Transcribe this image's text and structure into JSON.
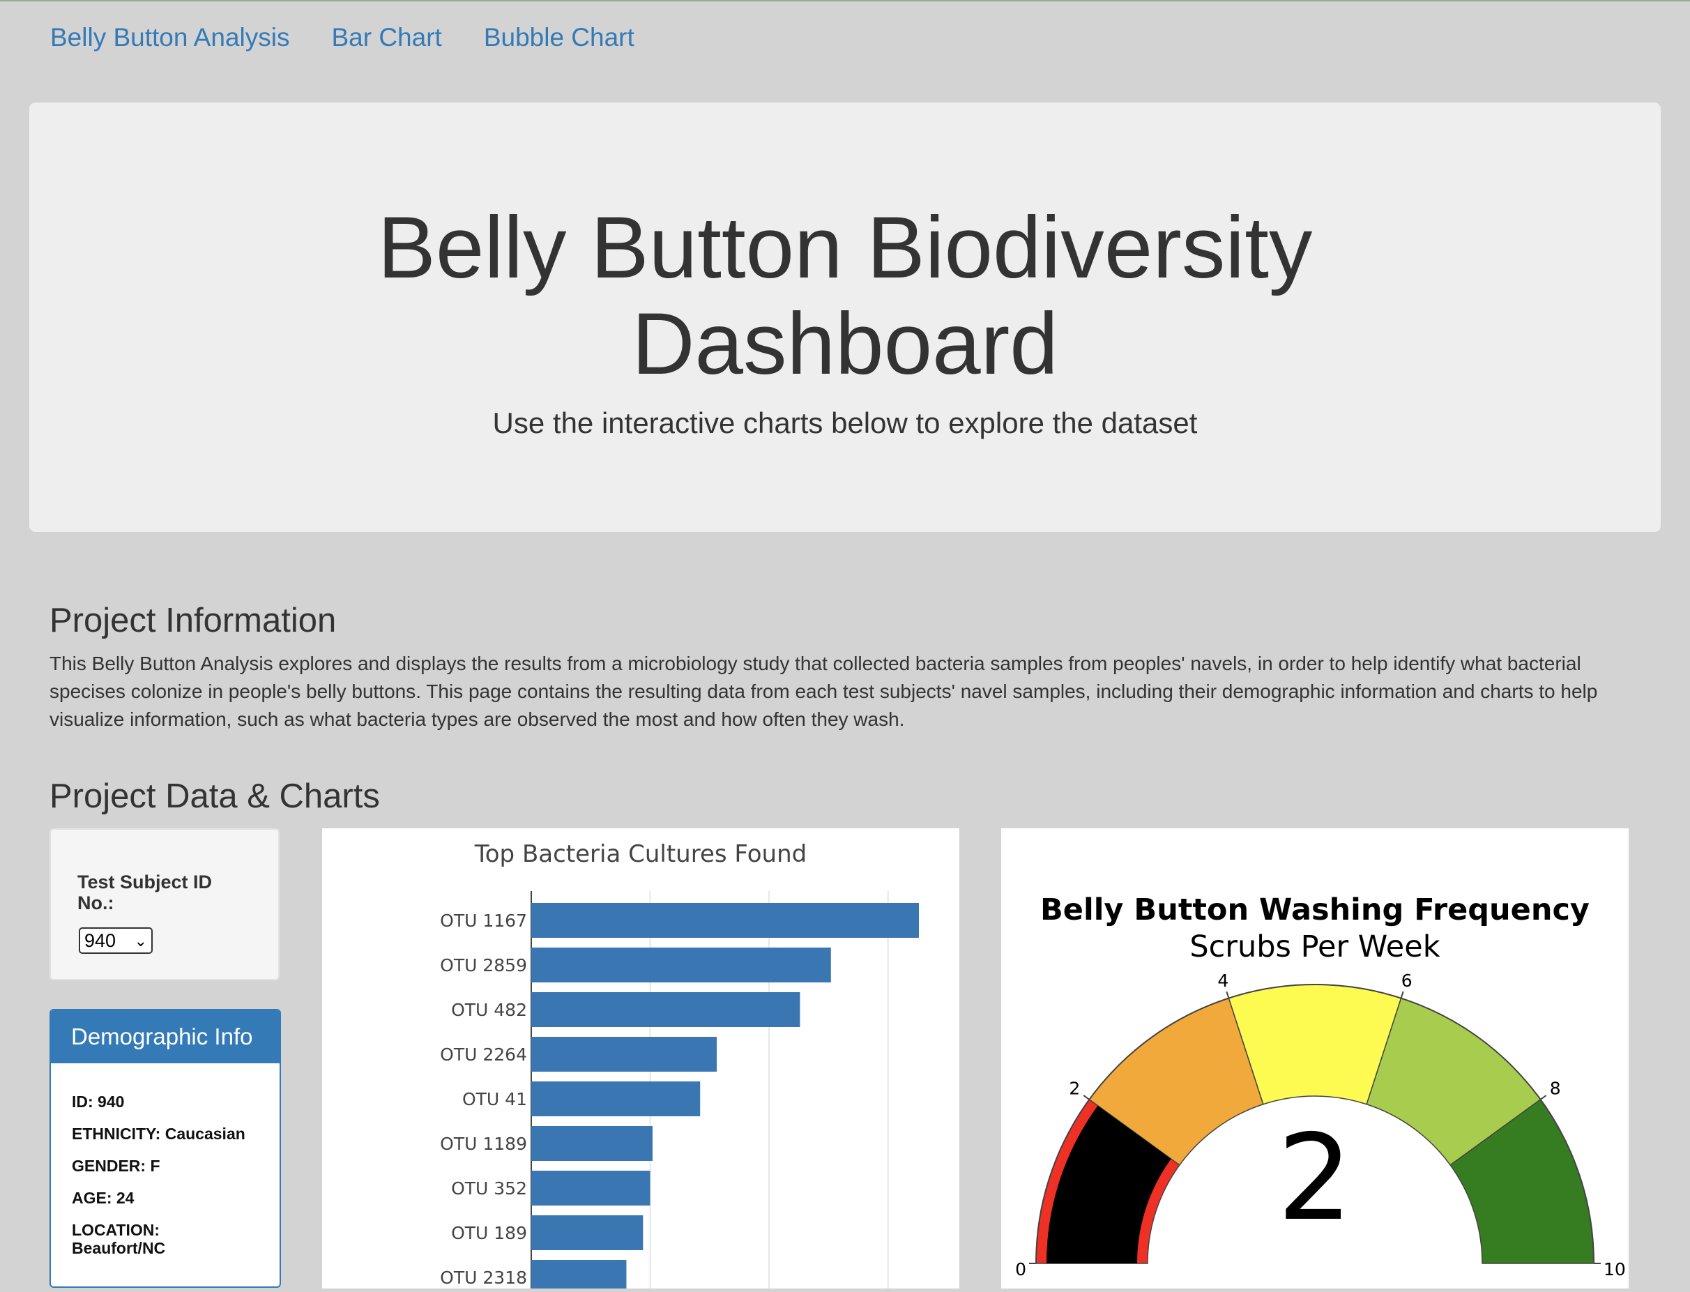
{
  "nav": {
    "items": [
      "Belly Button Analysis",
      "Bar Chart",
      "Bubble Chart"
    ]
  },
  "jumbotron": {
    "title_line1": "Belly Button Biodiversity",
    "title_line2": "Dashboard",
    "subtitle": "Use the interactive charts below to explore the dataset"
  },
  "project_info": {
    "heading": "Project Information",
    "text": "This Belly Button Analysis explores and displays the results from a microbiology study that collected bacteria samples from peoples' navels, in order to help identify what bacterial specises colonize in people's belly buttons. This page contains the resulting data from each test subjects' navel samples, including their demographic information and charts to help visualize information, such as what bacteria types are observed the most and how often they wash."
  },
  "project_data": {
    "heading": "Project Data & Charts"
  },
  "selector": {
    "label": "Test Subject ID No.:",
    "value": "940"
  },
  "demographic": {
    "title": "Demographic Info",
    "rows": [
      "ID: 940",
      "ETHNICITY: Caucasian",
      "GENDER: F",
      "AGE: 24",
      "LOCATION: Beaufort/NC"
    ]
  },
  "chart_data": [
    {
      "type": "bar",
      "orientation": "horizontal",
      "title": "Top Bacteria Cultures Found",
      "categories": [
        "OTU 1167",
        "OTU 2859",
        "OTU 482",
        "OTU 2264",
        "OTU 41",
        "OTU 1189",
        "OTU 352",
        "OTU 189",
        "OTU 2318"
      ],
      "values": [
        163,
        126,
        113,
        78,
        71,
        51,
        50,
        47,
        40
      ],
      "xlim": [
        0,
        180
      ],
      "grid": true,
      "bar_color": "#3a76b1"
    },
    {
      "type": "gauge",
      "title": "Belly Button Washing Frequency",
      "subtitle": "Scrubs Per Week",
      "value": 2,
      "range": [
        0,
        10
      ],
      "tick_labels": [
        "0",
        "2",
        "4",
        "6",
        "8",
        "10"
      ],
      "steps": [
        {
          "range": [
            0,
            2
          ],
          "color": "#ee3124"
        },
        {
          "range": [
            2,
            4
          ],
          "color": "#f0a93a"
        },
        {
          "range": [
            4,
            6
          ],
          "color": "#fdfa52"
        },
        {
          "range": [
            6,
            8
          ],
          "color": "#a8cd4e"
        },
        {
          "range": [
            8,
            10
          ],
          "color": "#367c21"
        }
      ],
      "bar_color": "#000000"
    }
  ]
}
